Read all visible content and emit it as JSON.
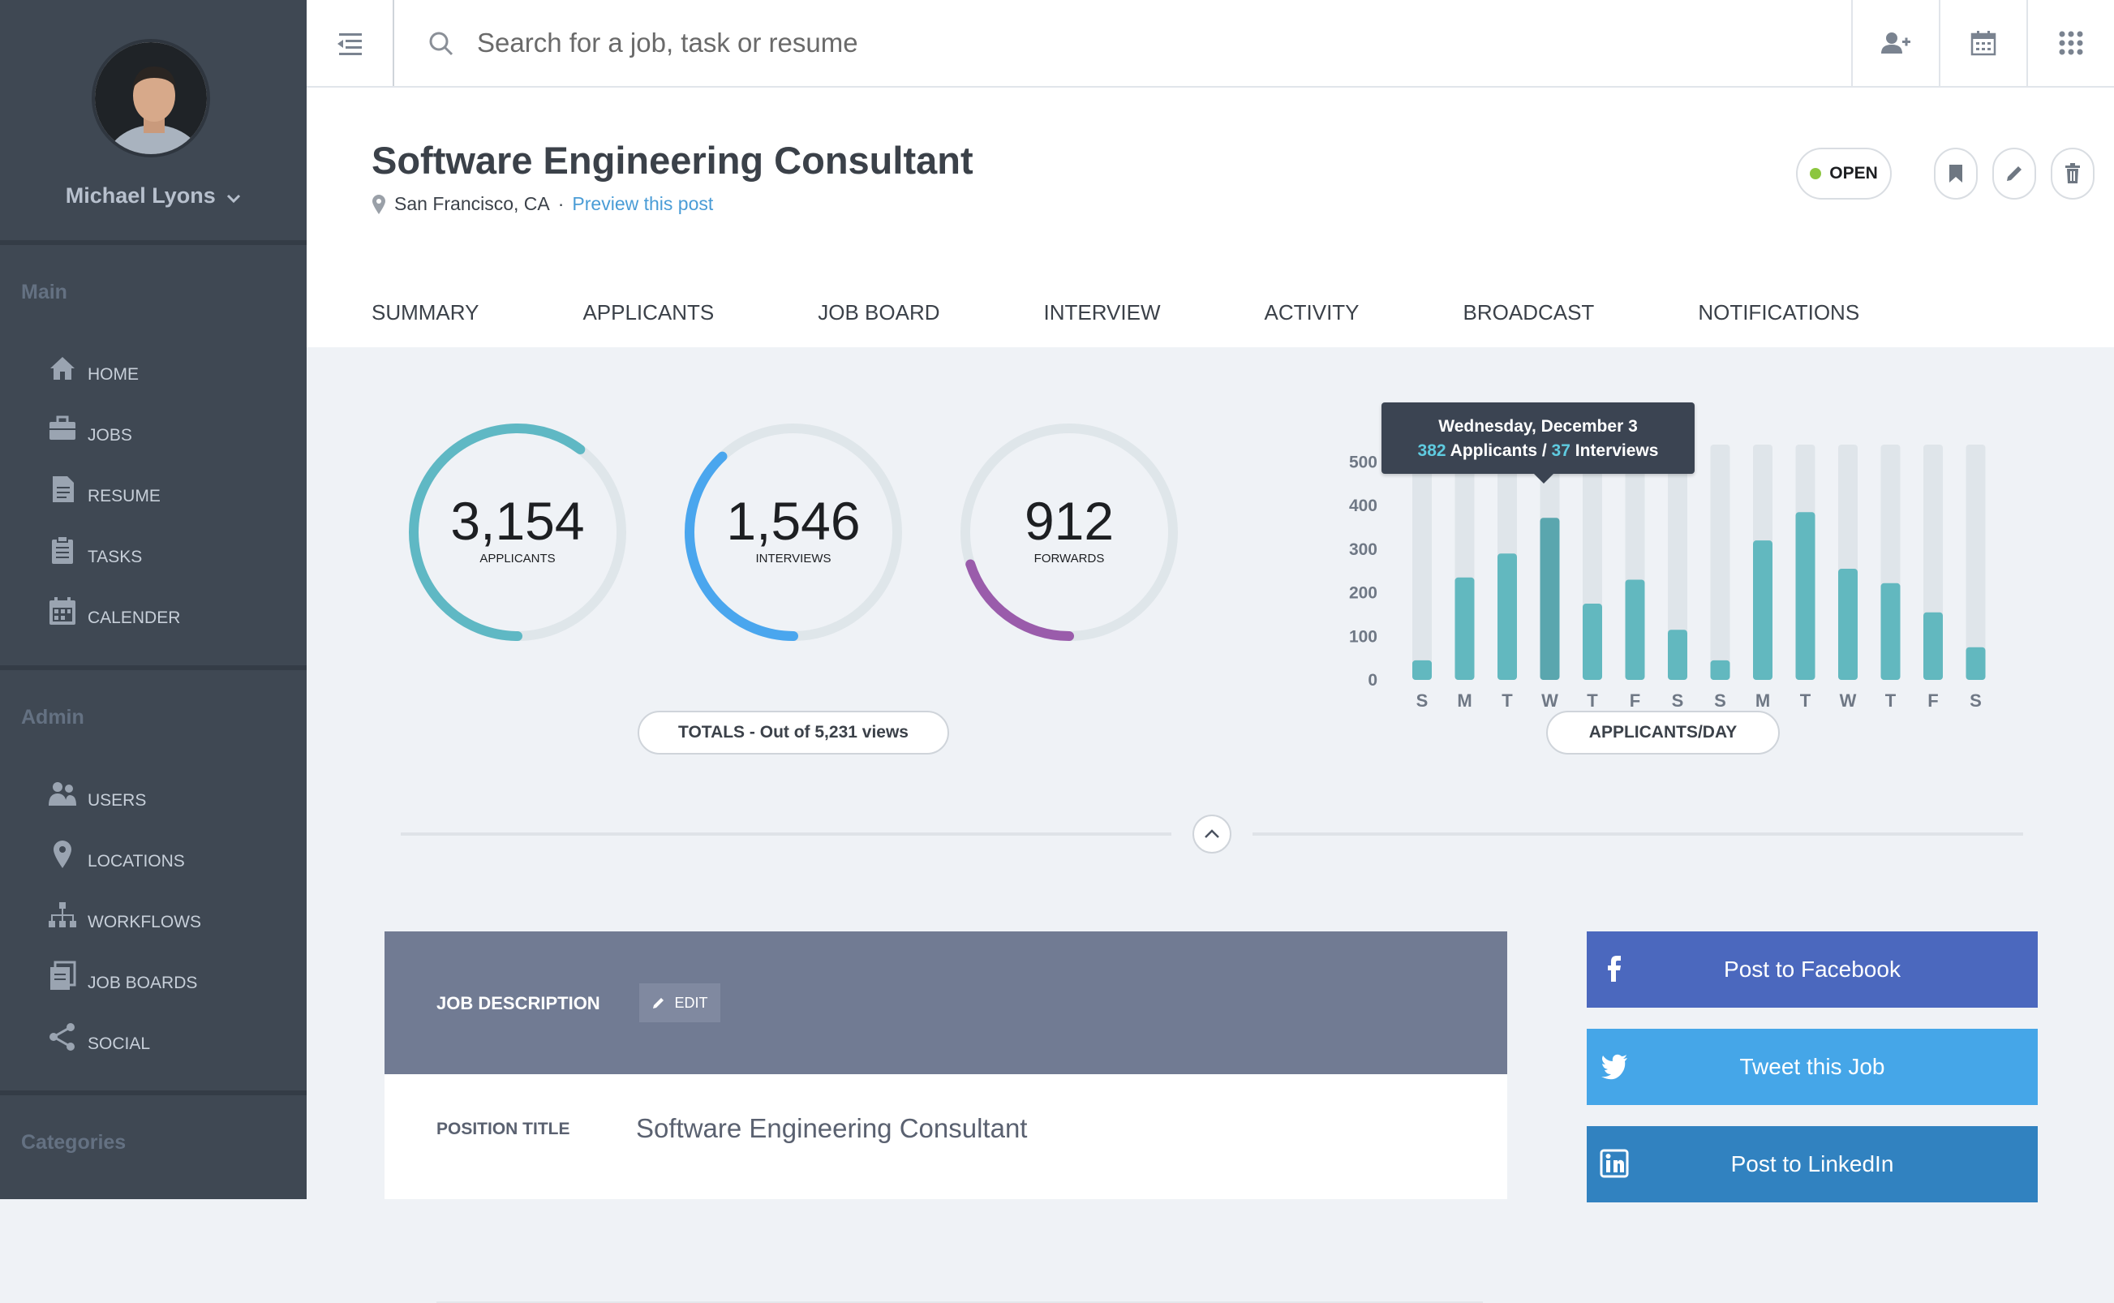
{
  "user": {
    "name": "Michael Lyons"
  },
  "sidebar": {
    "main_heading": "Main",
    "main_items": [
      {
        "label": "HOME",
        "icon": "home-icon"
      },
      {
        "label": "JOBS",
        "icon": "briefcase-icon"
      },
      {
        "label": "RESUME",
        "icon": "document-icon"
      },
      {
        "label": "TASKS",
        "icon": "clipboard-icon"
      },
      {
        "label": "CALENDER",
        "icon": "calendar-icon"
      }
    ],
    "admin_heading": "Admin",
    "admin_items": [
      {
        "label": "USERS",
        "icon": "users-icon"
      },
      {
        "label": "LOCATIONS",
        "icon": "location-pin-icon"
      },
      {
        "label": "WORKFLOWS",
        "icon": "hierarchy-icon"
      },
      {
        "label": "JOB BOARDS",
        "icon": "stack-icon"
      },
      {
        "label": "SOCIAL",
        "icon": "share-icon"
      }
    ],
    "categories_heading": "Categories"
  },
  "topbar": {
    "search_placeholder": "Search for a job, task or resume",
    "icons": [
      "menu-collapse-icon",
      "search-icon",
      "add-user-icon",
      "calendar-icon",
      "apps-grid-icon"
    ]
  },
  "job": {
    "title": "Software Engineering Consultant",
    "location": "San Francisco, CA",
    "preview_link": "Preview this post",
    "status": "OPEN",
    "status_color": "#8cc63f"
  },
  "tabs": [
    "SUMMARY",
    "APPLICANTS",
    "JOB BOARD",
    "INTERVIEW",
    "ACTIVITY",
    "BROADCAST",
    "NOTIFICATIONS"
  ],
  "totals": {
    "rings": [
      {
        "value": "3,154",
        "label": "APPLICANTS",
        "fraction": 0.603,
        "color": "#5fb8c4"
      },
      {
        "value": "1,546",
        "label": "INTERVIEWS",
        "fraction": 0.38,
        "color": "#4aa6ee"
      },
      {
        "value": "912",
        "label": "FORWARDS",
        "fraction": 0.2,
        "color": "#9a5cab"
      }
    ],
    "pill": "TOTALS - Out of 5,231 views"
  },
  "chart_data": {
    "type": "bar",
    "categories": [
      "S",
      "M",
      "T",
      "W",
      "T",
      "F",
      "S",
      "S",
      "M",
      "T",
      "W",
      "T",
      "F",
      "S"
    ],
    "values": [
      45,
      235,
      290,
      372,
      175,
      230,
      115,
      45,
      320,
      385,
      255,
      222,
      155,
      75
    ],
    "ylim": [
      0,
      540
    ],
    "yticks": [
      0,
      100,
      200,
      300,
      400,
      500
    ],
    "highlight_index": 3,
    "bar_color": "#62b8bf",
    "highlight_color": "#5aa6ae",
    "track_color": "#dfe5ea",
    "tooltip": {
      "title": "Wednesday, December 3",
      "applicants": "382",
      "applicants_label": "Applicants /",
      "interviews": "37",
      "interviews_label": "Interviews"
    },
    "pill": "APPLICANTS/DAY"
  },
  "description": {
    "heading": "JOB DESCRIPTION",
    "edit_label": "EDIT",
    "position_label": "POSITION TITLE",
    "position_value": "Software Engineering Consultant"
  },
  "social": [
    {
      "label": "Post to Facebook",
      "color": "#4b68be",
      "icon": "facebook-icon"
    },
    {
      "label": "Tweet this Job",
      "color": "#45a6e8",
      "icon": "twitter-icon"
    },
    {
      "label": "Post to LinkedIn",
      "color": "#3182c0",
      "icon": "linkedin-icon"
    }
  ]
}
